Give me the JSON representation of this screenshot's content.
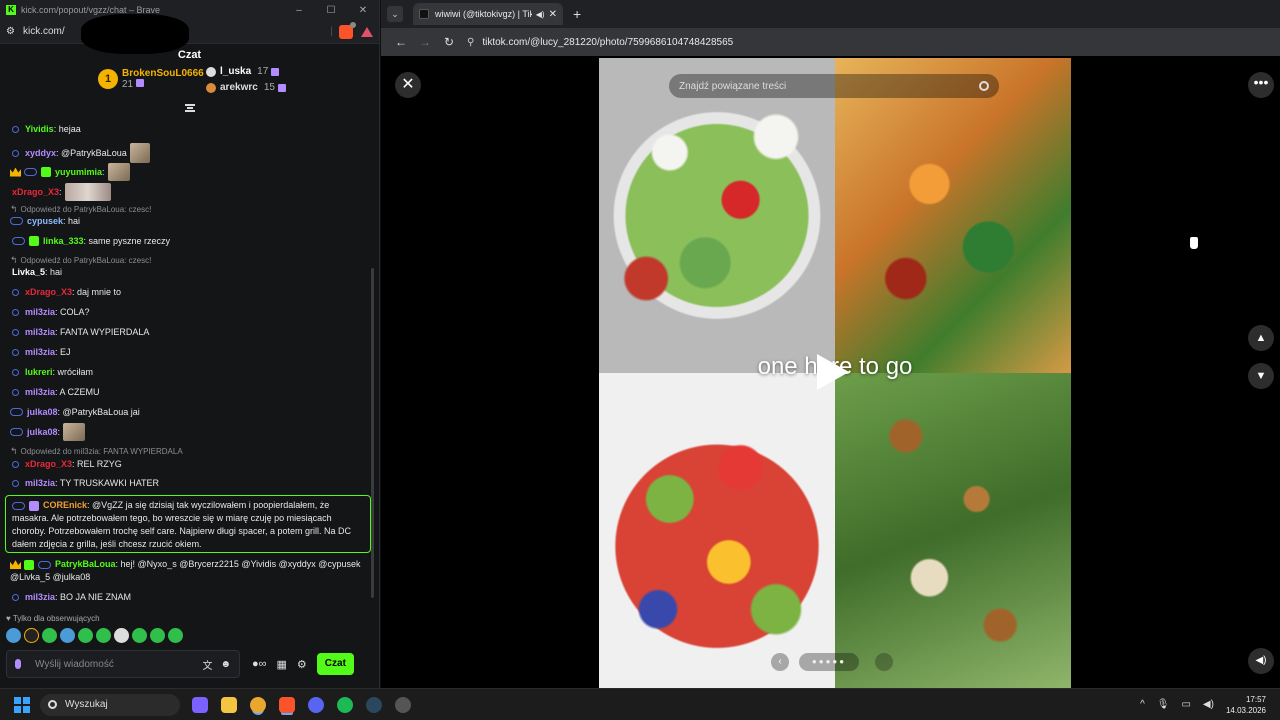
{
  "kick": {
    "window_title": "kick.com/popout/vgzz/chat – Brave",
    "url": "kick.com/",
    "header_title": "Czat",
    "leaderboard": [
      {
        "rank": "1",
        "name": "BrokenSouL0666",
        "count": "21",
        "color": "#f5b301"
      },
      {
        "name": "l_uska",
        "count": "17",
        "color": "#ffffff"
      },
      {
        "name": "arekwrc",
        "count": "15",
        "color": "#d98a3a"
      }
    ],
    "messages": [
      {
        "user": "Yividis",
        "text": ": hejaa",
        "color": "#53fc18"
      },
      {
        "user": "xyddyx",
        "text": ": @PatrykBaLoua",
        "color": "#b38cff"
      },
      {
        "user": "yuyumimia",
        "text": ":",
        "color": "#53fc18"
      },
      {
        "user": "xDrago_X3",
        "text": ":",
        "color": "#e8283a"
      },
      {
        "reply": "Odpowiedź do PatrykBaLoua: czesc!"
      },
      {
        "user": "cypusek",
        "text": ": hai",
        "color": "#8fb8ff"
      },
      {
        "user": "linka_333",
        "text": ": same pyszne rzeczy",
        "color": "#53fc18"
      },
      {
        "reply": "Odpowiedź do PatrykBaLoua: czesc!"
      },
      {
        "user": "Livka_5",
        "text": ": hai",
        "color": "#ffffff"
      },
      {
        "user": "xDrago_X3",
        "text": ": daj mnie to",
        "color": "#e8283a"
      },
      {
        "user": "mil3zia",
        "text": ": COLA?",
        "color": "#b38cff"
      },
      {
        "user": "mil3zia",
        "text": ": FANTA WYPIERDALA",
        "color": "#b38cff"
      },
      {
        "user": "mil3zia",
        "text": ": EJ",
        "color": "#b38cff"
      },
      {
        "user": "lukreri",
        "text": ": wróciłam",
        "color": "#53fc18"
      },
      {
        "user": "mil3zia",
        "text": ": A CZEMU",
        "color": "#b38cff"
      },
      {
        "user": "julka08",
        "text": ": @PatrykBaLoua jai",
        "color": "#b38cff"
      },
      {
        "user": "julka08",
        "text": ":",
        "color": "#b38cff"
      },
      {
        "reply": "Odpowiedź do mil3zia: FANTA WYPIERDALA"
      },
      {
        "user": "xDrago_X3",
        "text": ": REL RZYG",
        "color": "#e8283a"
      },
      {
        "user": "mil3zia",
        "text": ": TY TRUSKAWKI HATER",
        "color": "#b38cff"
      }
    ],
    "highlight": {
      "user": "COREnick",
      "text": ": @VgZZ ja się dzisiaj tak wyczilowałem i poopierdalałem, że masakra. Ale potrzebowałem tego, bo wreszcie się w miarę czuję po miesiącach choroby. Potrzebowałem trochę self care. Najpierw długi spacer, a potem grill. Na DC dałem zdjęcia z grilla, jeśli chcesz rzucić okiem.",
      "color": "#f0a030"
    },
    "patryk": {
      "user": "PatrykBaLoua",
      "text": ": hej! @Nyxo_s @Brycerz2215 @Yividis @xyddyx @cypusek @Livka_5 @julka08",
      "color": "#53fc18"
    },
    "last_message": {
      "user": "mil3zia",
      "text": ": BO JA NIE ZNAM",
      "color": "#b38cff"
    },
    "followers_only": "Tylko dla obserwujących",
    "input_placeholder": "Wyślij wiadomość",
    "send_label": "Czat"
  },
  "browser": {
    "tab_title": "wiwiwi (@tiktokivgz) | TikTok",
    "url": "tiktok.com/@lucy_281220/photo/7599686104748428565",
    "search_placeholder": "Znajdź powiązane treści",
    "overlay_text": "one here to go"
  },
  "taskbar": {
    "search_label": "Wyszukaj",
    "time": "17:57",
    "date": "14.03.2026",
    "apps": [
      {
        "name": "copilot-icon",
        "color": "#7b61ff"
      },
      {
        "name": "file-explorer-icon",
        "color": "#f5c542"
      },
      {
        "name": "chrome-icon",
        "color": "#e8a830"
      },
      {
        "name": "brave-icon",
        "color": "#fb542b"
      },
      {
        "name": "discord-icon",
        "color": "#5865f2"
      },
      {
        "name": "spotify-icon",
        "color": "#1db954"
      },
      {
        "name": "steam-icon",
        "color": "#1b2838"
      },
      {
        "name": "game-icon",
        "color": "#444444"
      }
    ]
  }
}
